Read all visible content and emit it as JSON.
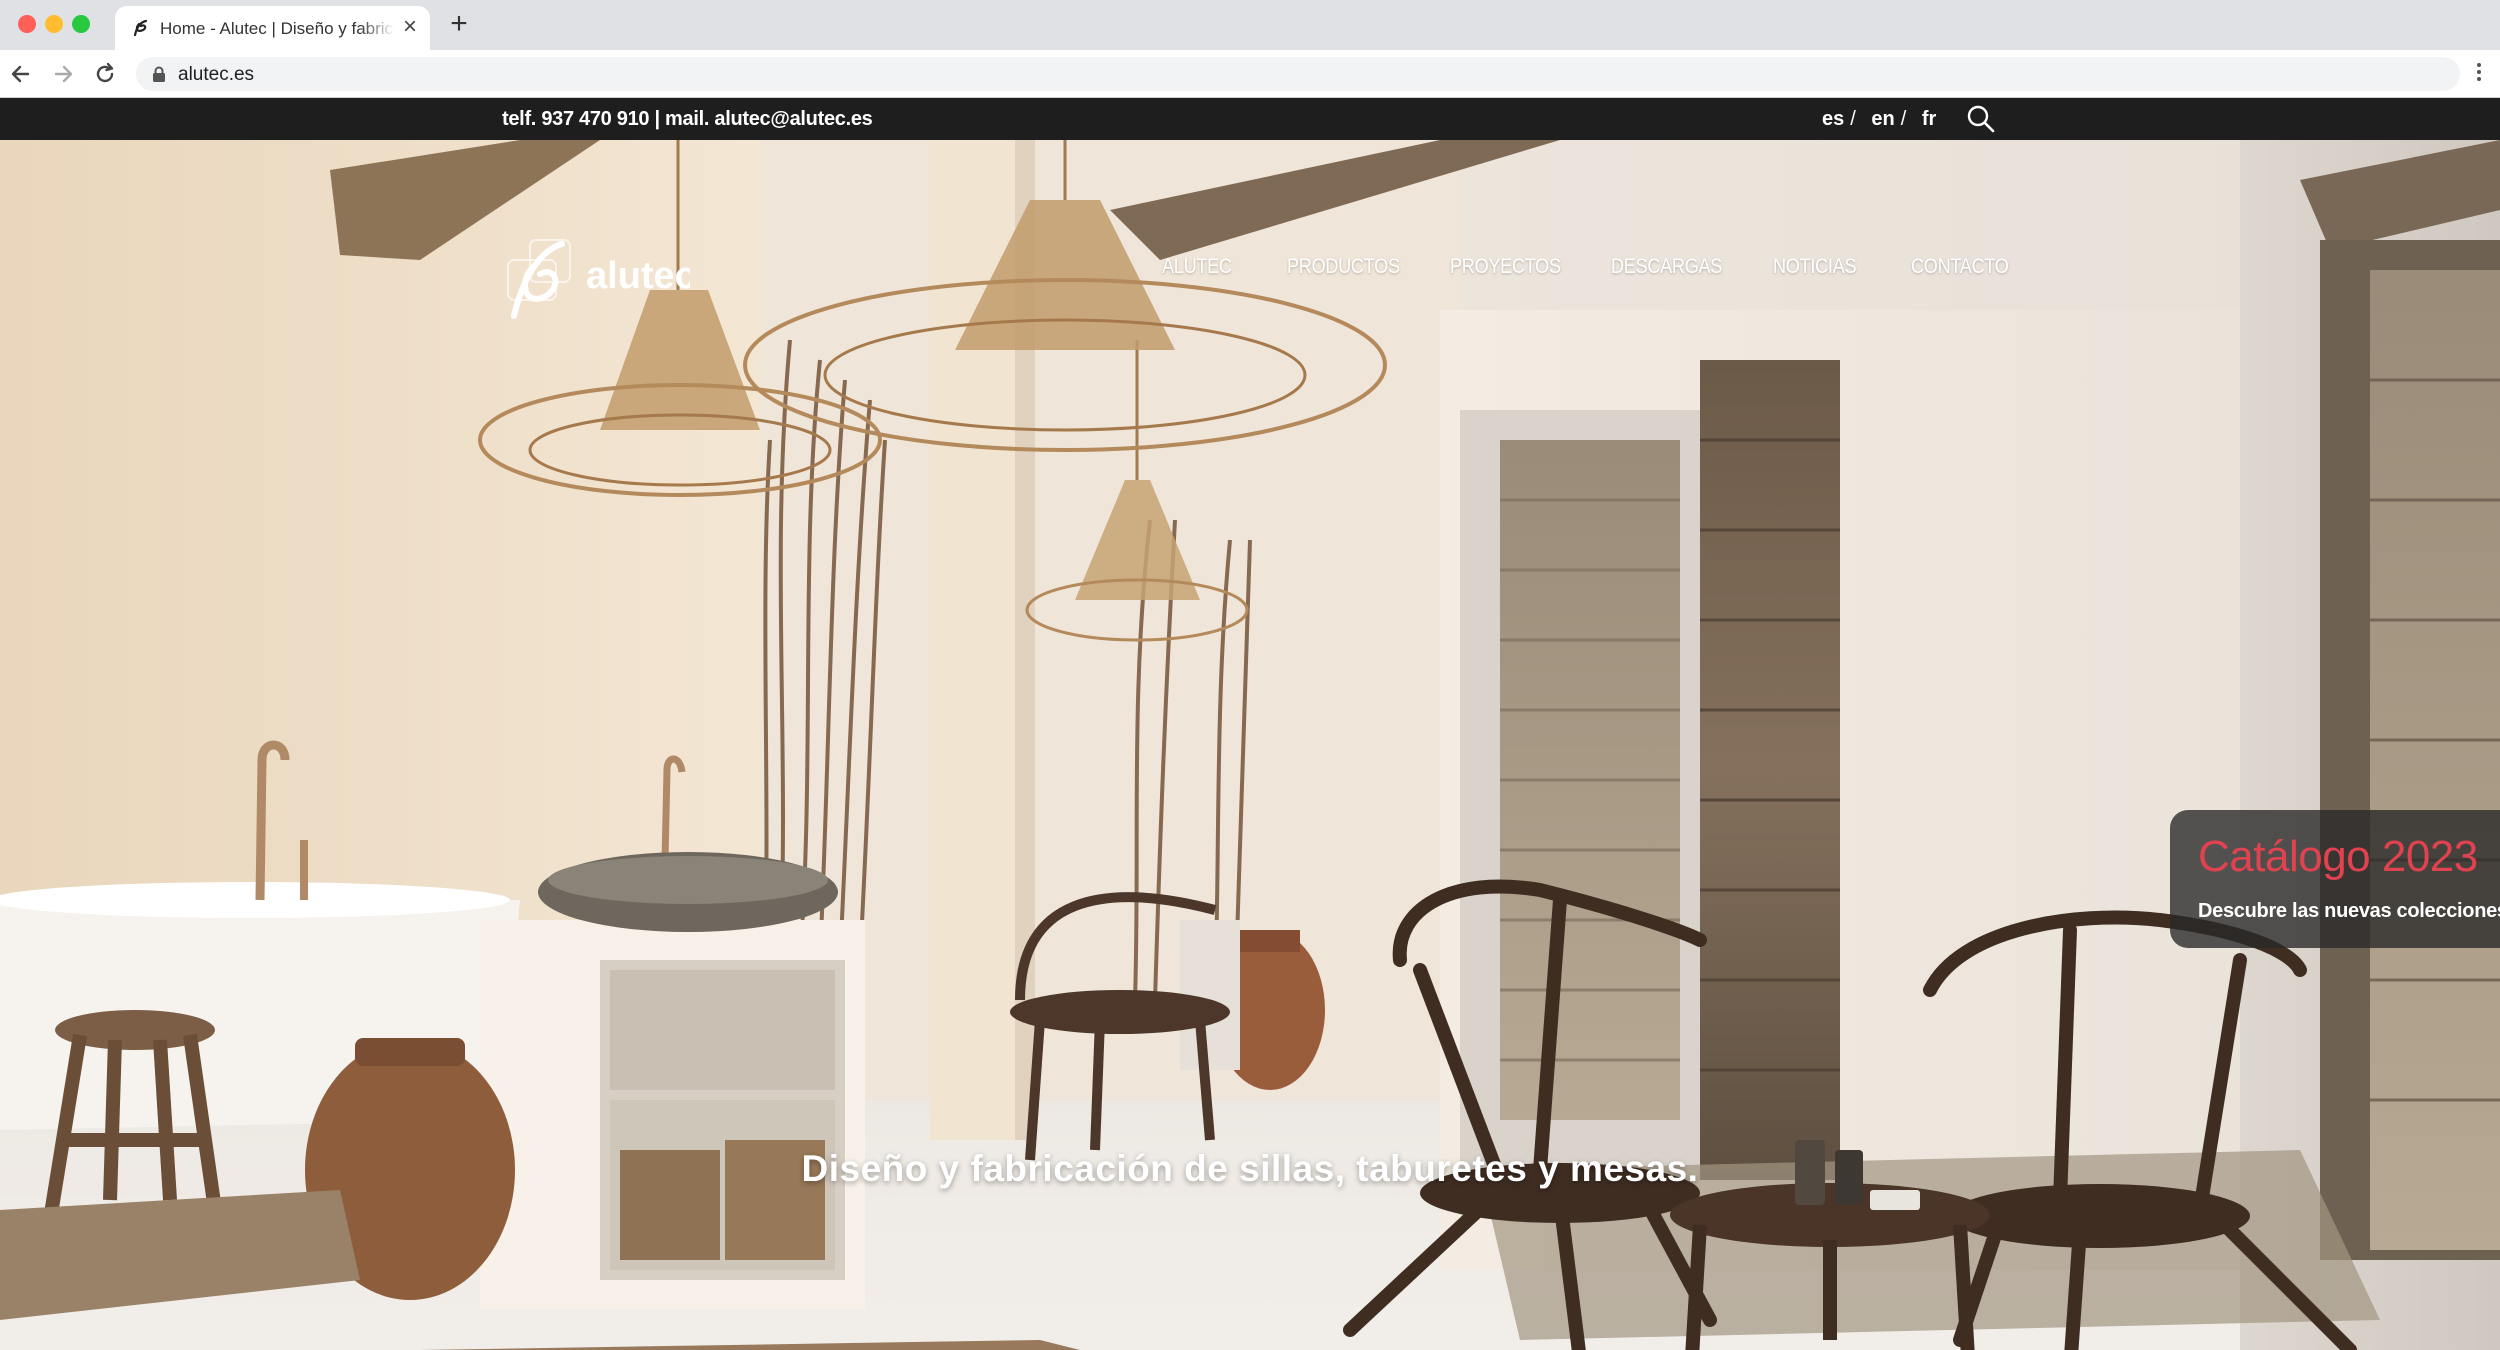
{
  "browser": {
    "tab_title": "Home - Alutec | Diseño y fabricación",
    "tab_close": "×",
    "new_tab": "+",
    "url": "alutec.es"
  },
  "topbar": {
    "contact": "telf. 937 470 910 | mail. alutec@alutec.es",
    "languages": [
      {
        "code": "es",
        "sep": "/"
      },
      {
        "code": "en",
        "sep": "/"
      },
      {
        "code": "fr",
        "sep": ""
      }
    ],
    "search_icon": "search-icon"
  },
  "header": {
    "logo_text": "alutec",
    "nav": [
      "ALUTEC",
      "PRODUCTOS",
      "PROYECTOS",
      "DESCARGAS",
      "NOTICIAS",
      "CONTACTO"
    ]
  },
  "catalog_card": {
    "title": "Catálogo 2023",
    "subtitle": "Descubre las nuevas colecciones",
    "title_color": "#e0434f"
  },
  "hero": {
    "tagline": "Diseño y fabricación de sillas, taburetes y mesas."
  },
  "colors": {
    "topbar_bg": "#1e1e1e",
    "accent": "#e0434f"
  }
}
